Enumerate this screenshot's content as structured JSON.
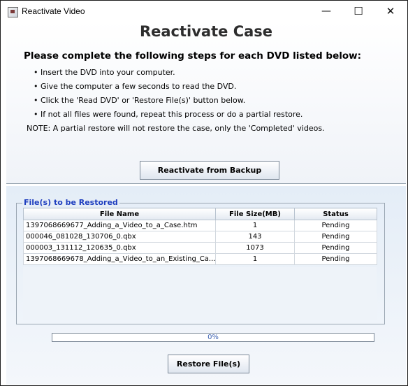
{
  "window": {
    "title": "Reactivate Video"
  },
  "titlebar": {
    "minimize": "—",
    "maximize": "☐",
    "close": "✕"
  },
  "header": {
    "heading": "Reactivate Case",
    "instructions_title": "Please complete the following steps for each DVD listed below:",
    "steps": [
      "• Insert the DVD into your computer.",
      "• Give the computer a few seconds to read the DVD.",
      "• Click the 'Read DVD' or 'Restore File(s)' button below.",
      "• If not all files were found, repeat this process or do a partial restore."
    ],
    "note": "NOTE: A partial restore will not restore the case, only the 'Completed' videos.",
    "reactivate_button": "Reactivate from Backup"
  },
  "files": {
    "group_title": "File(s) to be Restored",
    "columns": [
      "File Name",
      "File Size(MB)",
      "Status"
    ],
    "rows": [
      {
        "name": "1397068669677_Adding_a_Video_to_a_Case.htm",
        "size": "1",
        "status": "Pending"
      },
      {
        "name": "000046_081028_130706_0.qbx",
        "size": "143",
        "status": "Pending"
      },
      {
        "name": "000003_131112_120635_0.qbx",
        "size": "1073",
        "status": "Pending"
      },
      {
        "name": "1397068669678_Adding_a_Video_to_an_Existing_Ca...",
        "size": "1",
        "status": "Pending"
      }
    ]
  },
  "progress": {
    "value": 0,
    "label": "0%"
  },
  "restore_button": "Restore File(s)"
}
